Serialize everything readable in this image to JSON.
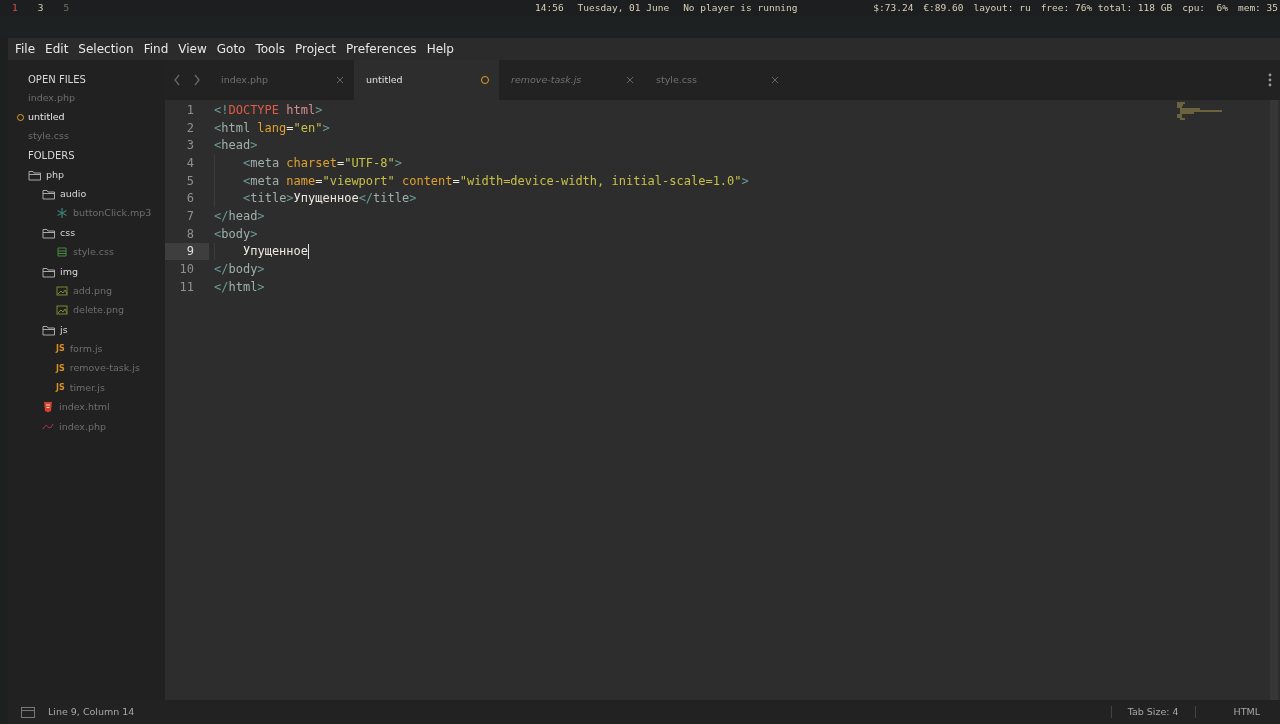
{
  "top_bar": {
    "workspaces": [
      {
        "label": "1",
        "selected": true,
        "occupied": true
      },
      {
        "label": "3",
        "selected": false,
        "occupied": true
      },
      {
        "label": "5",
        "selected": false,
        "occupied": false
      }
    ],
    "center": [
      "14:56",
      "Tuesday, 01 June",
      "No player is running"
    ],
    "right": [
      "$:73.24",
      "€:89.60",
      "layout: ru",
      "free: 76% total: 118 GB",
      "cpu:  6%",
      "mem: 35"
    ]
  },
  "menu": [
    "File",
    "Edit",
    "Selection",
    "Find",
    "View",
    "Goto",
    "Tools",
    "Project",
    "Preferences",
    "Help"
  ],
  "sidebar": {
    "open_files_title": "OPEN FILES",
    "open_files": [
      {
        "label": "index.php",
        "selected": false,
        "modified": false
      },
      {
        "label": "untitled",
        "selected": true,
        "modified": true
      },
      {
        "label": "style.css",
        "selected": false,
        "modified": false
      }
    ],
    "folders_title": "FOLDERS",
    "tree": [
      {
        "label": "php",
        "kind": "folder",
        "children": [
          {
            "label": "audio",
            "kind": "folder",
            "children": [
              {
                "label": "buttonClick.mp3",
                "kind": "audio"
              }
            ]
          },
          {
            "label": "css",
            "kind": "folder",
            "children": [
              {
                "label": "style.css",
                "kind": "css"
              }
            ]
          },
          {
            "label": "img",
            "kind": "folder",
            "children": [
              {
                "label": "add.png",
                "kind": "image"
              },
              {
                "label": "delete.png",
                "kind": "image"
              }
            ]
          },
          {
            "label": "js",
            "kind": "folder",
            "children": [
              {
                "label": "form.js",
                "kind": "js",
                "icon_text": "JS"
              },
              {
                "label": "remove-task.js",
                "kind": "js",
                "icon_text": "JS"
              },
              {
                "label": "timer.js",
                "kind": "js",
                "icon_text": "JS"
              }
            ]
          },
          {
            "label": "index.html",
            "kind": "html"
          },
          {
            "label": "index.php",
            "kind": "php"
          }
        ]
      }
    ]
  },
  "tabs": [
    {
      "label": "index.php",
      "selected": false,
      "modified": false,
      "preview": false
    },
    {
      "label": "untitled",
      "selected": true,
      "modified": true,
      "preview": false
    },
    {
      "label": "remove-task.js",
      "selected": false,
      "modified": false,
      "preview": true
    },
    {
      "label": "style.css",
      "selected": false,
      "modified": false,
      "preview": false
    }
  ],
  "code": [
    {
      "number": "1",
      "indented": false,
      "current": false,
      "tokens": [
        {
          "text": "<!",
          "kind": "punct"
        },
        {
          "text": "DOCTYPE",
          "kind": "keyword"
        },
        {
          "text": " html",
          "kind": "doctype"
        },
        {
          "text": ">",
          "kind": "punct"
        }
      ]
    },
    {
      "number": "2",
      "indented": false,
      "current": false,
      "tokens": [
        {
          "text": "<",
          "kind": "punct"
        },
        {
          "text": "html",
          "kind": "tag"
        },
        {
          "text": " lang",
          "kind": "attr"
        },
        {
          "text": "=",
          "kind": "plain"
        },
        {
          "text": "\"en\"",
          "kind": "string"
        },
        {
          "text": ">",
          "kind": "punct"
        }
      ]
    },
    {
      "number": "3",
      "indented": false,
      "current": false,
      "tokens": [
        {
          "text": "<",
          "kind": "punct"
        },
        {
          "text": "head",
          "kind": "tag"
        },
        {
          "text": ">",
          "kind": "punct"
        }
      ]
    },
    {
      "number": "4",
      "indented": true,
      "current": false,
      "tokens": [
        {
          "text": "<",
          "kind": "punct"
        },
        {
          "text": "meta",
          "kind": "tag"
        },
        {
          "text": " charset",
          "kind": "attr"
        },
        {
          "text": "=",
          "kind": "plain"
        },
        {
          "text": "\"UTF-8\"",
          "kind": "string"
        },
        {
          "text": ">",
          "kind": "punct"
        }
      ]
    },
    {
      "number": "5",
      "indented": true,
      "current": false,
      "tokens": [
        {
          "text": "<",
          "kind": "punct"
        },
        {
          "text": "meta",
          "kind": "tag"
        },
        {
          "text": " name",
          "kind": "attr"
        },
        {
          "text": "=",
          "kind": "plain"
        },
        {
          "text": "\"viewport\"",
          "kind": "string"
        },
        {
          "text": " content",
          "kind": "attr"
        },
        {
          "text": "=",
          "kind": "plain"
        },
        {
          "text": "\"width=device-width, initial-scale=1.0\"",
          "kind": "string"
        },
        {
          "text": ">",
          "kind": "punct"
        }
      ]
    },
    {
      "number": "6",
      "indented": true,
      "current": false,
      "tokens": [
        {
          "text": "<",
          "kind": "punct"
        },
        {
          "text": "title",
          "kind": "tag"
        },
        {
          "text": ">",
          "kind": "punct"
        },
        {
          "text": "Упущенное",
          "kind": "plain"
        },
        {
          "text": "</",
          "kind": "punct"
        },
        {
          "text": "title",
          "kind": "tag"
        },
        {
          "text": ">",
          "kind": "punct"
        }
      ]
    },
    {
      "number": "7",
      "indented": false,
      "current": false,
      "tokens": [
        {
          "text": "</",
          "kind": "punct"
        },
        {
          "text": "head",
          "kind": "tag"
        },
        {
          "text": ">",
          "kind": "punct"
        }
      ]
    },
    {
      "number": "8",
      "indented": false,
      "current": false,
      "tokens": [
        {
          "text": "<",
          "kind": "punct"
        },
        {
          "text": "body",
          "kind": "tag"
        },
        {
          "text": ">",
          "kind": "punct"
        }
      ]
    },
    {
      "number": "9",
      "indented": true,
      "current": true,
      "tokens": [
        {
          "text": "Упущенное",
          "kind": "plain"
        }
      ]
    },
    {
      "number": "10",
      "indented": false,
      "current": false,
      "tokens": [
        {
          "text": "</",
          "kind": "punct"
        },
        {
          "text": "body",
          "kind": "tag"
        },
        {
          "text": ">",
          "kind": "punct"
        }
      ]
    },
    {
      "number": "11",
      "indented": false,
      "current": false,
      "tokens": [
        {
          "text": "</",
          "kind": "punct"
        },
        {
          "text": "html",
          "kind": "tag"
        },
        {
          "text": ">",
          "kind": "punct"
        }
      ]
    }
  ],
  "status_bar": {
    "position": "Line 9, Column 14",
    "tab_size": "Tab Size: 4",
    "syntax": "HTML"
  }
}
